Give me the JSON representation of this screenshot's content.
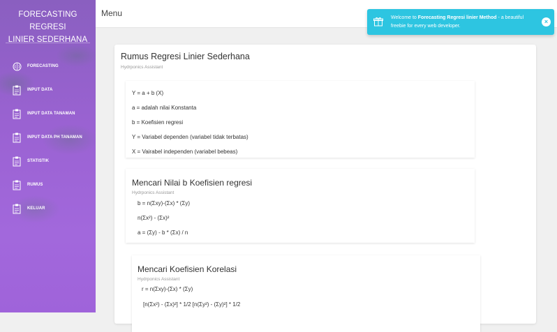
{
  "sidebar": {
    "brand_line1": "FORECASTING REGRESI",
    "brand_line2": "LINIER SEDERHANA",
    "items": [
      {
        "label": "FORECASTING",
        "icon": "brain-icon"
      },
      {
        "label": "INPUT DATA",
        "icon": "clipboard-icon"
      },
      {
        "label": "INPUT DATA TANAMAN",
        "icon": "clipboard-icon"
      },
      {
        "label": "INPUT DATA PH TANAMAN",
        "icon": "clipboard-icon"
      },
      {
        "label": "STATISTIK",
        "icon": "clipboard-icon"
      },
      {
        "label": "RUMUS",
        "icon": "clipboard-icon"
      },
      {
        "label": "KELUAR",
        "icon": "clipboard-icon"
      }
    ]
  },
  "topbar": {
    "menu_label": "Menu"
  },
  "toast": {
    "prefix": "Welcome to ",
    "bold": "Forecasting Regresi linier Method",
    "suffix": " - a beautiful freebie for every web developer.",
    "close": "×"
  },
  "card": {
    "title": "Rumus Regresi Linier Sederhana",
    "subtitle": "Hydrponics Assistant",
    "definitions": [
      "Y = a + b (X)",
      "a = adalah nilai Konstanta",
      "b = Koefisien regresi",
      "Y = Variabel dependen (variabel tidak terbatas)",
      "X = Vairabel independen (variabel bebeas)"
    ],
    "section_b": {
      "title": "Mencari Nilai b Koefisien regresi",
      "subtitle": "Hydrponics Assistant",
      "lines": [
        "b = n(Σxy)-(Σx) * (Σy)",
        "n(Σx²) - (Σx)²",
        "a = (Σy) - b * (Σx) / n"
      ]
    },
    "section_r": {
      "title": "Mencari Koefisien Korelasi",
      "subtitle": "Hydrponics Assistant",
      "lines": [
        "r = n(Σxy)-(Σx) * (Σy)",
        "[n(Σx²) - (Σx)²] * 1/2 [n(Σy²) - (Σy)²] * 1/2"
      ]
    }
  },
  "colors": {
    "sidebar": "#9a62d2",
    "toast": "#2dc5e1"
  }
}
